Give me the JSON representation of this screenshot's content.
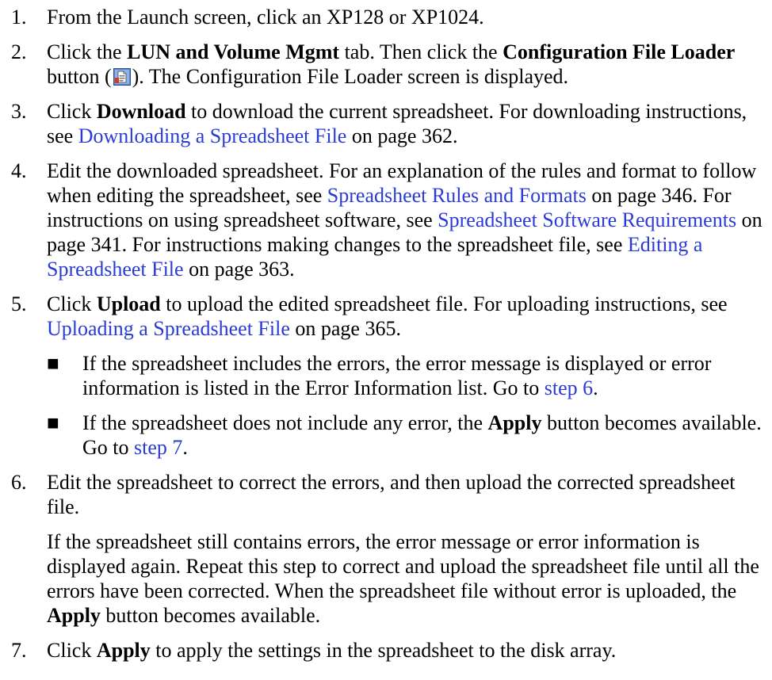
{
  "steps": {
    "s1": {
      "num": "1.",
      "t1": "From the Launch screen, click an XP128 or XP1024."
    },
    "s2": {
      "num": "2.",
      "t1": "Click the ",
      "b1": "LUN and Volume Mgmt",
      "t2": " tab. Then click the ",
      "b2": "Configuration File Loader",
      "t3": " button (",
      "icon": "configuration-file-loader-icon",
      "t4": "). The Configuration File Loader screen is displayed."
    },
    "s3": {
      "num": "3.",
      "t1": "Click ",
      "b1": "Download",
      "t2": " to download the current spreadsheet. For downloading instructions, see ",
      "l1": "Downloading a Spreadsheet File",
      "t3": " on page 362."
    },
    "s4": {
      "num": "4.",
      "t1": "Edit the downloaded spreadsheet. For an explanation of the rules and format to follow when editing the spreadsheet, see ",
      "l1": "Spreadsheet Rules and Formats",
      "t2": " on page 346. For instructions on using spreadsheet software, see ",
      "l2": "Spreadsheet Software Requirements",
      "t3": " on page 341. For instructions making changes to the spreadsheet file, see ",
      "l3": "Editing a Spreadsheet File",
      "t4": " on page 363."
    },
    "s5": {
      "num": "5.",
      "t1": "Click ",
      "b1": "Upload",
      "t2": " to upload the edited spreadsheet file. For uploading instructions, see ",
      "l1": "Uploading a Spreadsheet File",
      "t3": " on page 365.",
      "bullet_mark": "■",
      "bullets": [
        {
          "t1": "If the spreadsheet includes the errors, the error message is displayed or error information is listed in the Error Information list. Go to ",
          "l1": "step 6",
          "t2": "."
        },
        {
          "t1": "If the spreadsheet does not include any error, the ",
          "b1": "Apply",
          "t2": " button becomes available. Go to ",
          "l1": "step 7",
          "t3": "."
        }
      ]
    },
    "s6": {
      "num": "6.",
      "t1": "Edit the spreadsheet to correct the errors, and then upload the corrected spreadsheet file.",
      "p2_t1": "If the spreadsheet still contains errors, the error message or error information is displayed again. Repeat this step to correct and upload the spreadsheet file until all the errors have been corrected. When the spreadsheet file without error is uploaded, the ",
      "p2_b1": "Apply",
      "p2_t2": " button becomes available."
    },
    "s7": {
      "num": "7.",
      "t1": "Click ",
      "b1": "Apply",
      "t2": " to apply the settings in the spreadsheet to the disk array."
    }
  },
  "colors": {
    "link": "#2a3bd6",
    "text": "#000000"
  }
}
